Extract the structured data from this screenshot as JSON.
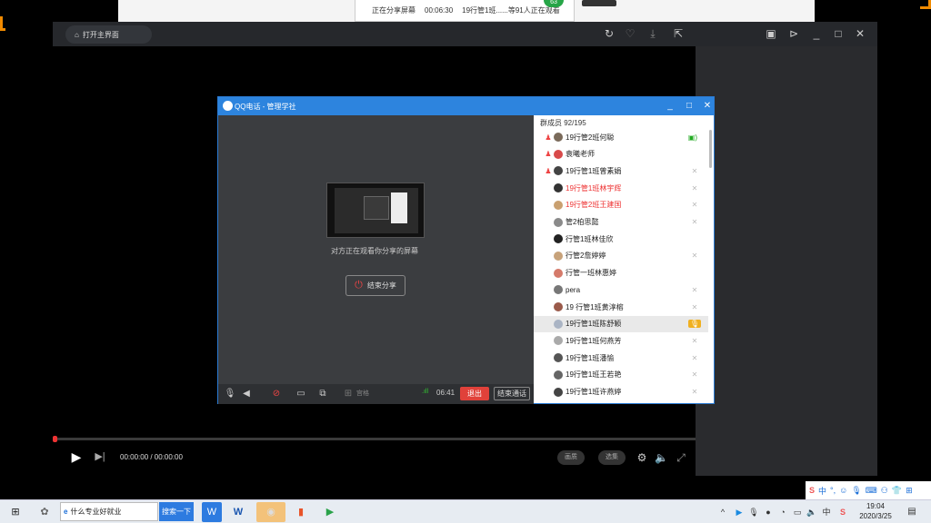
{
  "share_bar": {
    "status": "正在分享屏幕",
    "duration": "00:06:30",
    "viewers": "19行管1班......等91人正在观看",
    "badge": "63"
  },
  "player": {
    "home_label": "打开主界面",
    "time": "00:00:00 / 00:00:00",
    "quality_label": "画质",
    "episodes_label": "选集",
    "progress": 0.0
  },
  "qq": {
    "title": "QQ电话 - 管理学社",
    "watch_text": "对方正在观看你分享的屏幕",
    "stop_share": "结束分享",
    "grid_label": "宫格",
    "call_time": "06:41",
    "exit": "退出",
    "end_call": "结束通话",
    "members_header": "群成员 92/195",
    "members": [
      {
        "name": "19行管2班何聪",
        "admin": true,
        "status": "camera-mic",
        "red": false,
        "avatar": "#7a6a5a"
      },
      {
        "name": "袁曦老师",
        "admin": true,
        "status": "none",
        "red": false,
        "avatar": "#d84a4a"
      },
      {
        "name": "19行管1班曾素娟",
        "admin": true,
        "status": "muted",
        "red": false,
        "avatar": "#444"
      },
      {
        "name": "19行管1班林宇辉",
        "admin": false,
        "status": "muted",
        "red": true,
        "avatar": "#333"
      },
      {
        "name": "19行管2班王建国",
        "admin": false,
        "status": "muted",
        "red": true,
        "avatar": "#c9a070"
      },
      {
        "name": "管2柏思懿",
        "admin": false,
        "status": "muted",
        "red": false,
        "avatar": "#8a8a8a"
      },
      {
        "name": "行管1班林佳欣",
        "admin": false,
        "status": "none",
        "red": false,
        "avatar": "#222"
      },
      {
        "name": "行管2詹婷婷",
        "admin": false,
        "status": "muted",
        "red": false,
        "avatar": "#c7a27a"
      },
      {
        "name": "行管一班林惠婷",
        "admin": false,
        "status": "none",
        "red": false,
        "avatar": "#d57a6a"
      },
      {
        "name": "pera",
        "admin": false,
        "status": "muted",
        "red": false,
        "avatar": "#777"
      },
      {
        "name": "19 行管1班黄淳榕",
        "admin": false,
        "status": "muted",
        "red": false,
        "avatar": "#9a5a4a"
      },
      {
        "name": "19行管1班陈舒颖",
        "admin": false,
        "status": "mic",
        "red": false,
        "avatar": "#aab4c4"
      },
      {
        "name": "19行管1班何燕芳",
        "admin": false,
        "status": "muted",
        "red": false,
        "avatar": "#aaa"
      },
      {
        "name": "19行管1班潘愉",
        "admin": false,
        "status": "muted",
        "red": false,
        "avatar": "#555"
      },
      {
        "name": "19行管1班王若艳",
        "admin": false,
        "status": "muted",
        "red": false,
        "avatar": "#666"
      },
      {
        "name": "19行管1班许燕婷",
        "admin": false,
        "status": "muted",
        "red": false,
        "avatar": "#444"
      }
    ]
  },
  "taskbar": {
    "search_text": "什么专业好就业",
    "search_button": "搜索一下",
    "ime_text": "中",
    "time": "19:04",
    "date": "2020/3/25"
  }
}
